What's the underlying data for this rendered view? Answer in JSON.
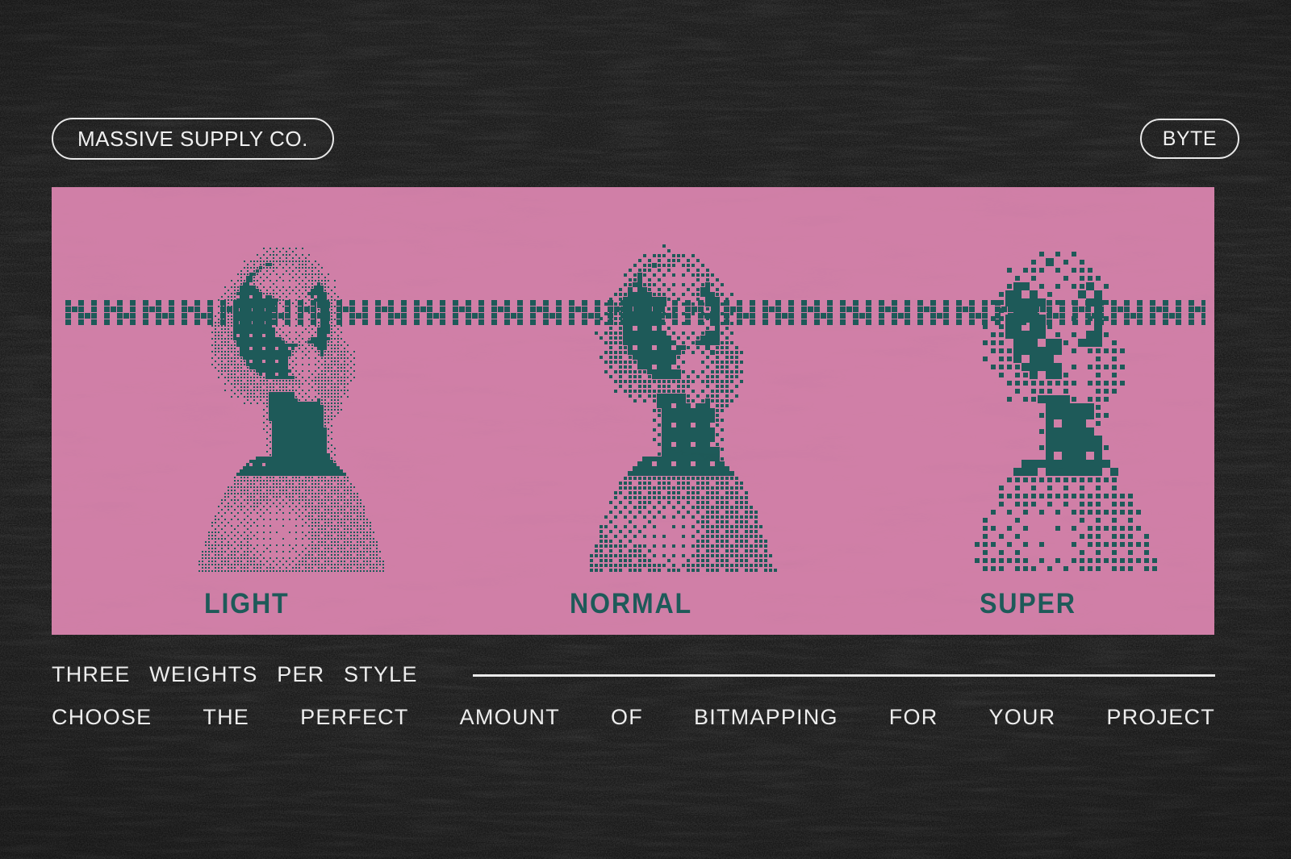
{
  "header": {
    "brand_badge": "MASSIVE SUPPLY CO.",
    "product_badge": "BYTE"
  },
  "panel": {
    "background_color": "#d07fa7",
    "ink_color": "#1e5a59",
    "specimens": [
      {
        "label": "LIGHT",
        "dot_size": 4,
        "threshold_bias": 0.0
      },
      {
        "label": "NORMAL",
        "dot_size": 6,
        "threshold_bias": 0.02
      },
      {
        "label": "SUPER",
        "dot_size": 10,
        "threshold_bias": 0.05
      }
    ],
    "dither_band": {
      "cell": 8,
      "rows": 4
    }
  },
  "footer": {
    "line1": "THREE  WEIGHTS  PER  STYLE",
    "line2_words": [
      "CHOOSE",
      "THE",
      "PERFECT",
      "AMOUNT",
      "OF",
      "BITMAPPING",
      "FOR",
      "YOUR",
      "PROJECT"
    ]
  },
  "colors": {
    "background": "#191919",
    "pink": "#d07fa7",
    "teal": "#1e5a59",
    "stroke": "#ebebeb"
  }
}
